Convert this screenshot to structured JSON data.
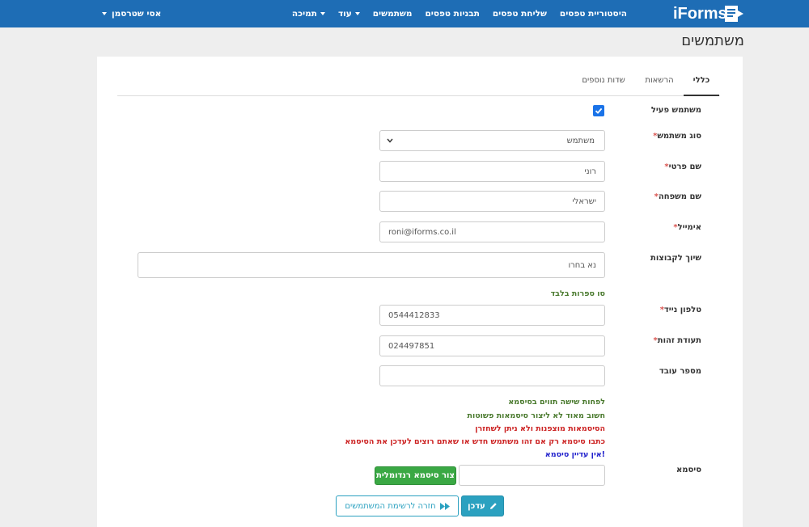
{
  "brand": {
    "name": "iForms"
  },
  "nav": {
    "history": "היסטוריית טפסים",
    "send_forms": "שליחת טפסים",
    "form_templates": "תבניות טפסים",
    "users": "משתמשים",
    "more": "עוד",
    "support": "תמיכה",
    "user_name": "אסי שטרסמן"
  },
  "page": {
    "title": "משתמשים"
  },
  "tabs": {
    "general": "כללי",
    "permissions": "הרשאות",
    "extra_fields": "שדות נוספים"
  },
  "form": {
    "active_label": "משתמש פעיל",
    "active_checked": true,
    "user_type_label": "סוג משתמש",
    "user_type_value": "משתמש",
    "first_name_label": "שם פרטי",
    "first_name_value": "רוני",
    "last_name_label": "שם משפחה",
    "last_name_value": "ישראלי",
    "email_label": "אימייל",
    "email_value": "roni@iforms.co.il",
    "groups_label": "שיוך לקבוצות",
    "groups_placeholder": "נא בחרו",
    "digits_hint": "סו ספרות בלבד",
    "mobile_label": "טלפון נייד",
    "mobile_value": "0544412833",
    "id_label": "תעודת זהות",
    "id_value": "024497851",
    "employee_no_label": "מספר עובד",
    "employee_no_value": "",
    "password_label": "סיסמא",
    "password_value": "",
    "required_mark": "*"
  },
  "password_hints": {
    "min_chars": "לפחות שישה תווים בסיסמא",
    "not_simple": "חשוב מאוד לא ליצור סיסמאות פשוטות",
    "encrypted": "הסיסמאות מוצפנות ולא ניתן לשחזרן",
    "only_if": "כתבו סיסמא רק אם זהו משתמש חדש או שאתם רוצים לעדכן את הסיסמא",
    "no_password": "אין עדיין סיסמא!"
  },
  "buttons": {
    "generate_password": "צור סיסמא רנדומלית",
    "update": "עדכן",
    "back_to_list": "חזרה לרשימת המשתמשים"
  },
  "colors": {
    "navbar": "#1e6db5",
    "green_button": "#3aa844",
    "info_button": "#2ba1c0",
    "checkbox": "#1a73e8"
  }
}
